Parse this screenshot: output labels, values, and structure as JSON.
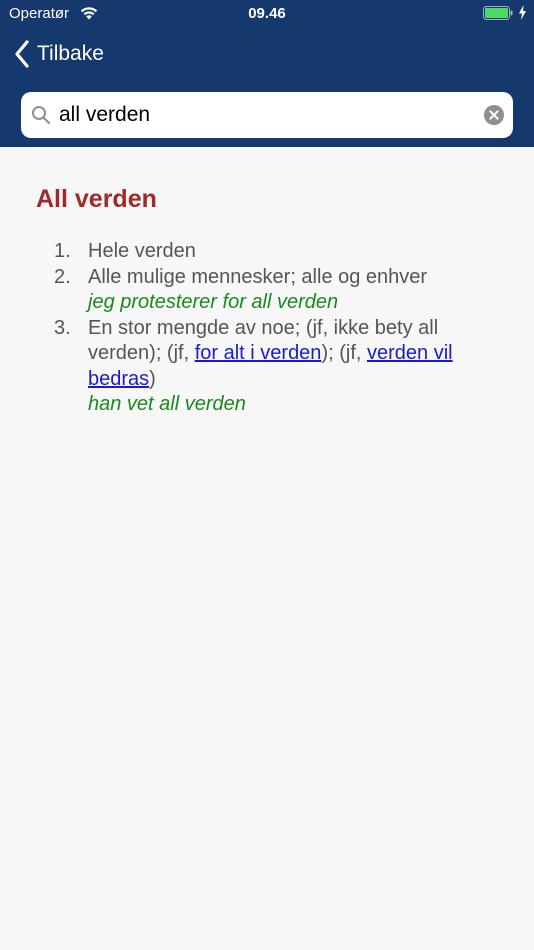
{
  "status_bar": {
    "carrier": "Operatør",
    "time": "09.46",
    "battery_color": "#4cd964"
  },
  "nav": {
    "back_label": "Tilbake"
  },
  "search": {
    "value": "all verden"
  },
  "entry": {
    "title": "All verden",
    "title_color": "#a1282b",
    "senses": [
      {
        "number": "1.",
        "text": "Hele verden"
      },
      {
        "number": "2.",
        "text": "Alle mulige mennesker; alle og enhver",
        "example": "jeg protesterer for all verden"
      },
      {
        "number": "3.",
        "text_before": "En stor mengde av noe; (jf, ikke bety all verden); (jf, ",
        "link1": "for alt i verden",
        "text_middle": "); (jf, ",
        "link2": "verden vil bedras",
        "text_after": ")",
        "example": "han vet all verden"
      }
    ]
  },
  "colors": {
    "header_bg": "#16396d",
    "example": "#1a8a1a",
    "link": "#1a1ad6"
  }
}
